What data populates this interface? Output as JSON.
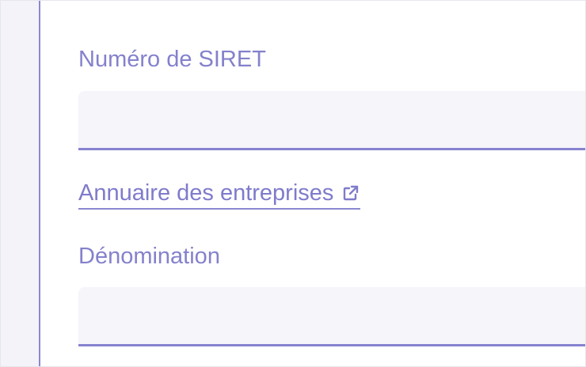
{
  "form": {
    "siret_label": "Numéro de SIRET",
    "siret_value": "",
    "directory_link_label": "Annuaire des entreprises",
    "denomination_label": "Dénomination",
    "denomination_value": ""
  },
  "icons": {
    "external_link": "external-link-icon"
  },
  "colors": {
    "accent": "#8481cc",
    "field_background": "#f5f5fa",
    "field_border": "#8783cf",
    "side_panel": "#f3f3f9"
  }
}
